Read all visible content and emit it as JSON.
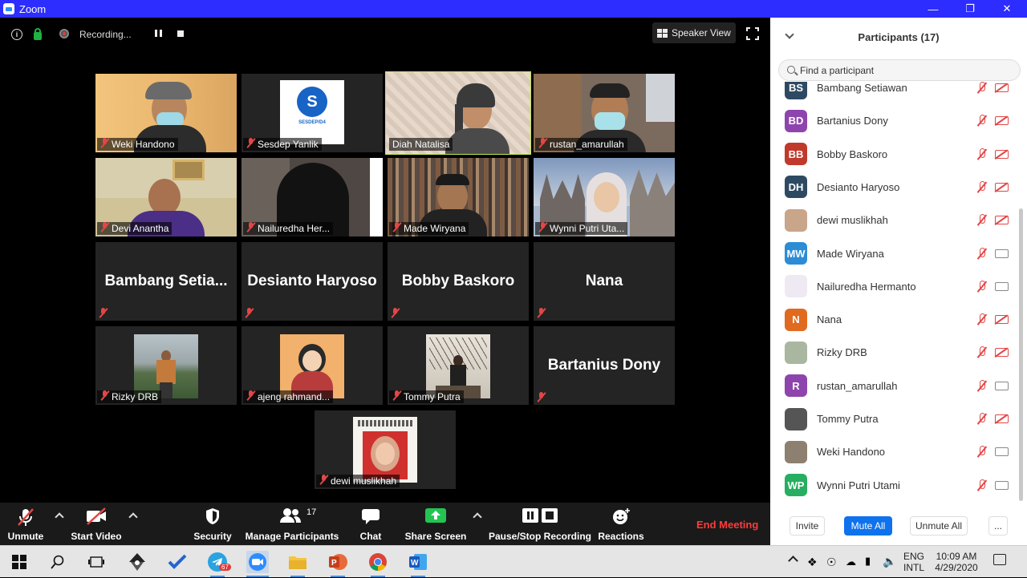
{
  "window": {
    "title": "Zoom"
  },
  "topbar": {
    "recording_label": "Recording...",
    "speaker_view_label": "Speaker View"
  },
  "tiles": [
    {
      "name": "Weki Handono",
      "kind": "video"
    },
    {
      "name": "Sesdep Yanlik",
      "kind": "video",
      "logo_text": "S",
      "logo_caption": "SESDEP/D4"
    },
    {
      "name": "Diah Natalisa",
      "kind": "video",
      "active": true
    },
    {
      "name": "rustan_amarullah",
      "kind": "video"
    },
    {
      "name": "Devi Anantha",
      "kind": "video"
    },
    {
      "name": "Nailuredha Her...",
      "kind": "video"
    },
    {
      "name": "Made Wiryana",
      "kind": "video"
    },
    {
      "name": "Wynni Putri Uta...",
      "kind": "video"
    },
    {
      "name": "Bambang  Setia...",
      "kind": "name"
    },
    {
      "name": "Desianto Haryoso",
      "kind": "name"
    },
    {
      "name": "Bobby Baskoro",
      "kind": "name"
    },
    {
      "name": "Nana",
      "kind": "name"
    },
    {
      "name": "Rizky DRB",
      "kind": "photo"
    },
    {
      "name": "ajeng rahmand...",
      "kind": "photo"
    },
    {
      "name": "Tommy Putra",
      "kind": "photo"
    },
    {
      "name": "Bartanius Dony",
      "kind": "name"
    },
    {
      "name": "dewi muslikhah",
      "kind": "photo"
    }
  ],
  "toolbar": {
    "unmute": "Unmute",
    "start_video": "Start Video",
    "security": "Security",
    "manage_participants": "Manage Participants",
    "participant_count": "17",
    "chat": "Chat",
    "share_screen": "Share Screen",
    "pause_stop_recording": "Pause/Stop Recording",
    "reactions": "Reactions",
    "end_meeting": "End Meeting"
  },
  "panel": {
    "title": "Participants (17)",
    "search_placeholder": "Find a participant",
    "participants": [
      {
        "initials": "BS",
        "name": "Bambang Setiawan",
        "color": "#2e4a62",
        "video_off": true
      },
      {
        "initials": "BD",
        "name": "Bartanius Dony",
        "color": "#8e44ad",
        "video_off": true
      },
      {
        "initials": "BB",
        "name": "Bobby Baskoro",
        "color": "#c0392b",
        "video_off": true
      },
      {
        "initials": "DH",
        "name": "Desianto Haryoso",
        "color": "#2e4a62",
        "video_off": true
      },
      {
        "initials": "",
        "name": "dewi muslikhah",
        "color": "#c9a58a",
        "video_off": true
      },
      {
        "initials": "MW",
        "name": "Made Wiryana",
        "color": "#2d8cd6",
        "video_off": false
      },
      {
        "initials": "",
        "name": "Nailuredha Hermanto",
        "color": "#efe9f3",
        "video_off": false
      },
      {
        "initials": "N",
        "name": "Nana",
        "color": "#e06a1f",
        "video_off": true
      },
      {
        "initials": "",
        "name": "Rizky DRB",
        "color": "#aab7a0",
        "video_off": true
      },
      {
        "initials": "R",
        "name": "rustan_amarullah",
        "color": "#8e44ad",
        "video_off": false
      },
      {
        "initials": "",
        "name": "Tommy Putra",
        "color": "#555555",
        "video_off": true
      },
      {
        "initials": "",
        "name": "Weki Handono",
        "color": "#8d8070",
        "video_off": false
      },
      {
        "initials": "WP",
        "name": "Wynni Putri Utami",
        "color": "#27ae60",
        "video_off": false
      }
    ],
    "invite": "Invite",
    "mute_all": "Mute All",
    "unmute_all": "Unmute All",
    "more": "..."
  },
  "taskbar": {
    "lang_top": "ENG",
    "lang_bottom": "INTL",
    "time": "10:09 AM",
    "date": "4/29/2020",
    "telegram_badge": "67"
  }
}
